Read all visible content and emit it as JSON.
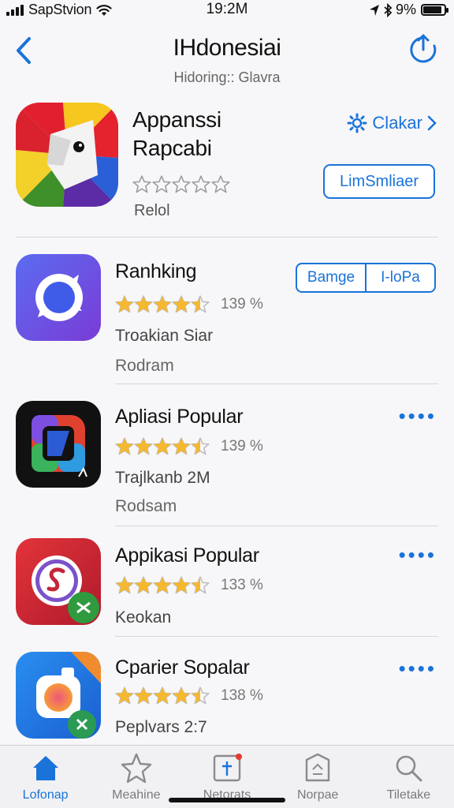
{
  "status_bar": {
    "carrier": "SapStvion",
    "time": "19:2M",
    "battery": "9%",
    "battery_level": 0.9
  },
  "nav": {
    "title": "IHdonesiai",
    "subtitle": "Hidoring:: Glavra",
    "back_icon": "chevron-left-icon",
    "share_icon": "share-icon"
  },
  "featured": {
    "title_line1": "Appanssi",
    "title_line2": "Rapcabi",
    "rating_stars": 0,
    "subtitle": "Relol",
    "link_label": "Clakar",
    "button_label": "LimSmliaer"
  },
  "apps": [
    {
      "title": "Ranhking",
      "rating_stars": 4.5,
      "rating_count": "139 %",
      "line_a": "Troakian Siar",
      "line_b": "Rodram",
      "segment_left": "Bamge",
      "segment_right": "I-loPa"
    },
    {
      "title": "Apliasi Popular",
      "rating_stars": 4.5,
      "rating_count": "139 %",
      "line_a": "Trajlkanb 2M",
      "line_b": "Rodsam",
      "more_label": "••••"
    },
    {
      "title": "Appikasi Popular",
      "rating_stars": 4.5,
      "rating_count": "133 %",
      "line_a": "Keokan",
      "more_label": "••••"
    },
    {
      "title": "Cparier Sopalar",
      "rating_stars": 4.5,
      "rating_count": "138 %",
      "line_a": "Peplvars 2:7",
      "more_label": "••••"
    }
  ],
  "tabs": [
    {
      "label": "Lofonap",
      "icon": "home-icon",
      "active": true
    },
    {
      "label": "Meahine",
      "icon": "star-icon",
      "active": false
    },
    {
      "label": "Netorats",
      "icon": "notification-icon",
      "active": false
    },
    {
      "label": "Norpae",
      "icon": "document-icon",
      "active": false
    },
    {
      "label": "Tiletake",
      "icon": "search-icon",
      "active": false
    }
  ],
  "colors": {
    "accent": "#1a73d9",
    "star": "#f5b82e"
  }
}
